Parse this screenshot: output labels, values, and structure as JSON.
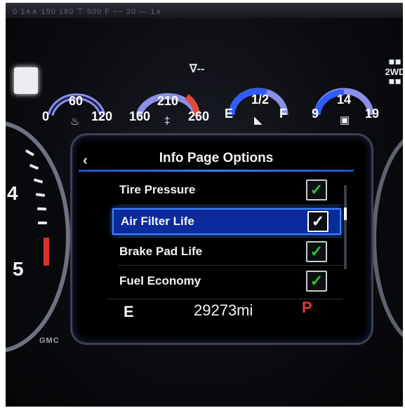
{
  "top_strip": {
    "text": "0  1∧∧  150  180  ⊤  500  F  −−  20  —  1∧"
  },
  "indicators": {
    "cruise": "∇--",
    "drive_mode": "2WD",
    "drive_mode_icon": "tires-icon"
  },
  "gauges": [
    {
      "name": "oil-pressure",
      "low": "0",
      "mid": "60",
      "high": "120",
      "icon": "oil-can-icon",
      "icon_glyph": "♨"
    },
    {
      "name": "coolant-temp",
      "low": "160",
      "mid": "210",
      "high": "260",
      "icon": "thermometer-icon",
      "icon_glyph": "‡"
    },
    {
      "name": "fuel",
      "low": "E",
      "mid": "1/2",
      "high": "F",
      "icon": "fuel-pump-icon",
      "icon_glyph": "◣"
    },
    {
      "name": "battery",
      "low": "9",
      "mid": "14",
      "high": "19",
      "icon": "battery-icon",
      "icon_glyph": "▣"
    }
  ],
  "left_dial": {
    "num_upper": "4",
    "num_lower": "5"
  },
  "brand": "GMC",
  "screen": {
    "back_label": "‹",
    "title": "Info Page Options",
    "options": [
      {
        "label": "Tire Pressure",
        "checked": "✓",
        "selected": false
      },
      {
        "label": "Air Filter Life",
        "checked": "✓",
        "selected": true
      },
      {
        "label": "Brake Pad Life",
        "checked": "✓",
        "selected": false
      },
      {
        "label": "Fuel Economy",
        "checked": "✓",
        "selected": false
      }
    ],
    "status": {
      "fuel": "E",
      "odometer": "29273mi",
      "gear": "P"
    }
  },
  "colors": {
    "accent": "#3f83ff",
    "selected_bg": "#0b2a9c",
    "check_green": "#29c52f",
    "gear_red": "#e53b34",
    "gauge_arc": "#8b8fe9"
  }
}
